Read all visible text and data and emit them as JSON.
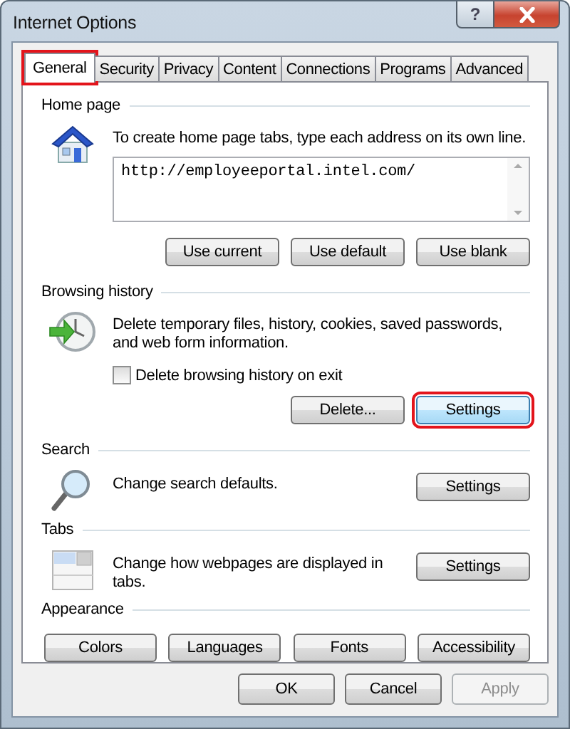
{
  "window": {
    "title": "Internet Options",
    "help_button": "?"
  },
  "tabs": [
    {
      "label": "General",
      "selected": true,
      "highlighted": true
    },
    {
      "label": "Security",
      "selected": false,
      "highlighted": false
    },
    {
      "label": "Privacy",
      "selected": false,
      "highlighted": false
    },
    {
      "label": "Content",
      "selected": false,
      "highlighted": false
    },
    {
      "label": "Connections",
      "selected": false,
      "highlighted": false
    },
    {
      "label": "Programs",
      "selected": false,
      "highlighted": false
    },
    {
      "label": "Advanced",
      "selected": false,
      "highlighted": false
    }
  ],
  "home_page": {
    "title": "Home page",
    "description": "To create home page tabs, type each address on its own line.",
    "address": "http://employeeportal.intel.com/",
    "buttons": [
      {
        "label": "Use current",
        "highlighted": false
      },
      {
        "label": "Use default",
        "highlighted": false
      },
      {
        "label": "Use blank",
        "highlighted": false
      }
    ]
  },
  "browsing_history": {
    "title": "Browsing history",
    "description": "Delete temporary files, history, cookies, saved passwords, and web form information.",
    "checkbox": {
      "label": "Delete browsing history on exit",
      "checked": false
    },
    "buttons": [
      {
        "label": "Delete...",
        "highlighted": false
      },
      {
        "label": "Settings",
        "highlighted": true
      }
    ]
  },
  "search": {
    "title": "Search",
    "description": "Change search defaults.",
    "button": {
      "label": "Settings",
      "highlighted": false
    }
  },
  "tabs_section": {
    "title": "Tabs",
    "description": "Change how webpages are displayed in tabs.",
    "button": {
      "label": "Settings",
      "highlighted": false
    }
  },
  "appearance": {
    "title": "Appearance",
    "buttons": [
      {
        "label": "Colors",
        "highlighted": false
      },
      {
        "label": "Languages",
        "highlighted": false
      },
      {
        "label": "Fonts",
        "highlighted": false
      },
      {
        "label": "Accessibility",
        "highlighted": false
      }
    ]
  },
  "footer_buttons": [
    {
      "label": "OK",
      "disabled": false
    },
    {
      "label": "Cancel",
      "disabled": false
    },
    {
      "label": "Apply",
      "disabled": true
    }
  ]
}
